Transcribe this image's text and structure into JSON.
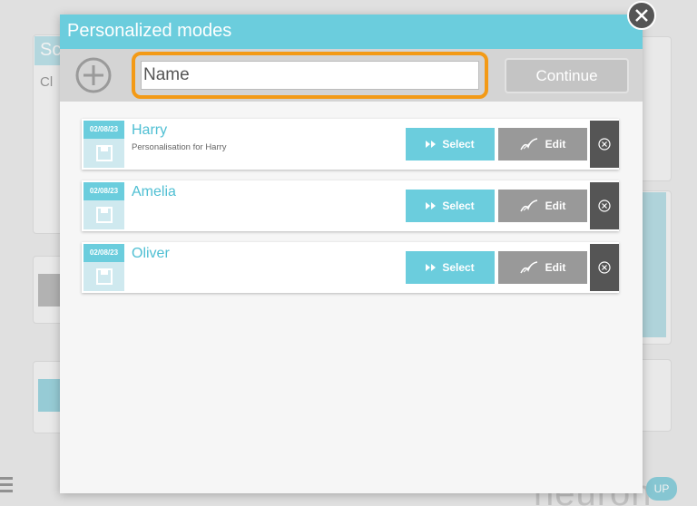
{
  "background": {
    "tab_text": "Sc",
    "label_text": "Cl",
    "brand_text": "neuron",
    "up_badge": "UP"
  },
  "modal": {
    "title": "Personalized modes",
    "name_placeholder": "Name",
    "name_value": "",
    "continue_label": "Continue",
    "modes": [
      {
        "date": "02/08/23",
        "name": "Harry",
        "description": "Personalisation for Harry",
        "select_label": "Select",
        "edit_label": "Edit"
      },
      {
        "date": "02/08/23",
        "name": "Amelia",
        "description": "",
        "select_label": "Select",
        "edit_label": "Edit"
      },
      {
        "date": "02/08/23",
        "name": "Oliver",
        "description": "",
        "select_label": "Select",
        "edit_label": "Edit"
      }
    ]
  },
  "colors": {
    "accent": "#6bcddd",
    "highlight": "#f39a16",
    "edit": "#999999",
    "delete": "#555555"
  },
  "icons": [
    "add-icon",
    "close-icon",
    "save-icon",
    "fast-forward-icon",
    "edit-brush-icon",
    "delete-circle-icon"
  ]
}
